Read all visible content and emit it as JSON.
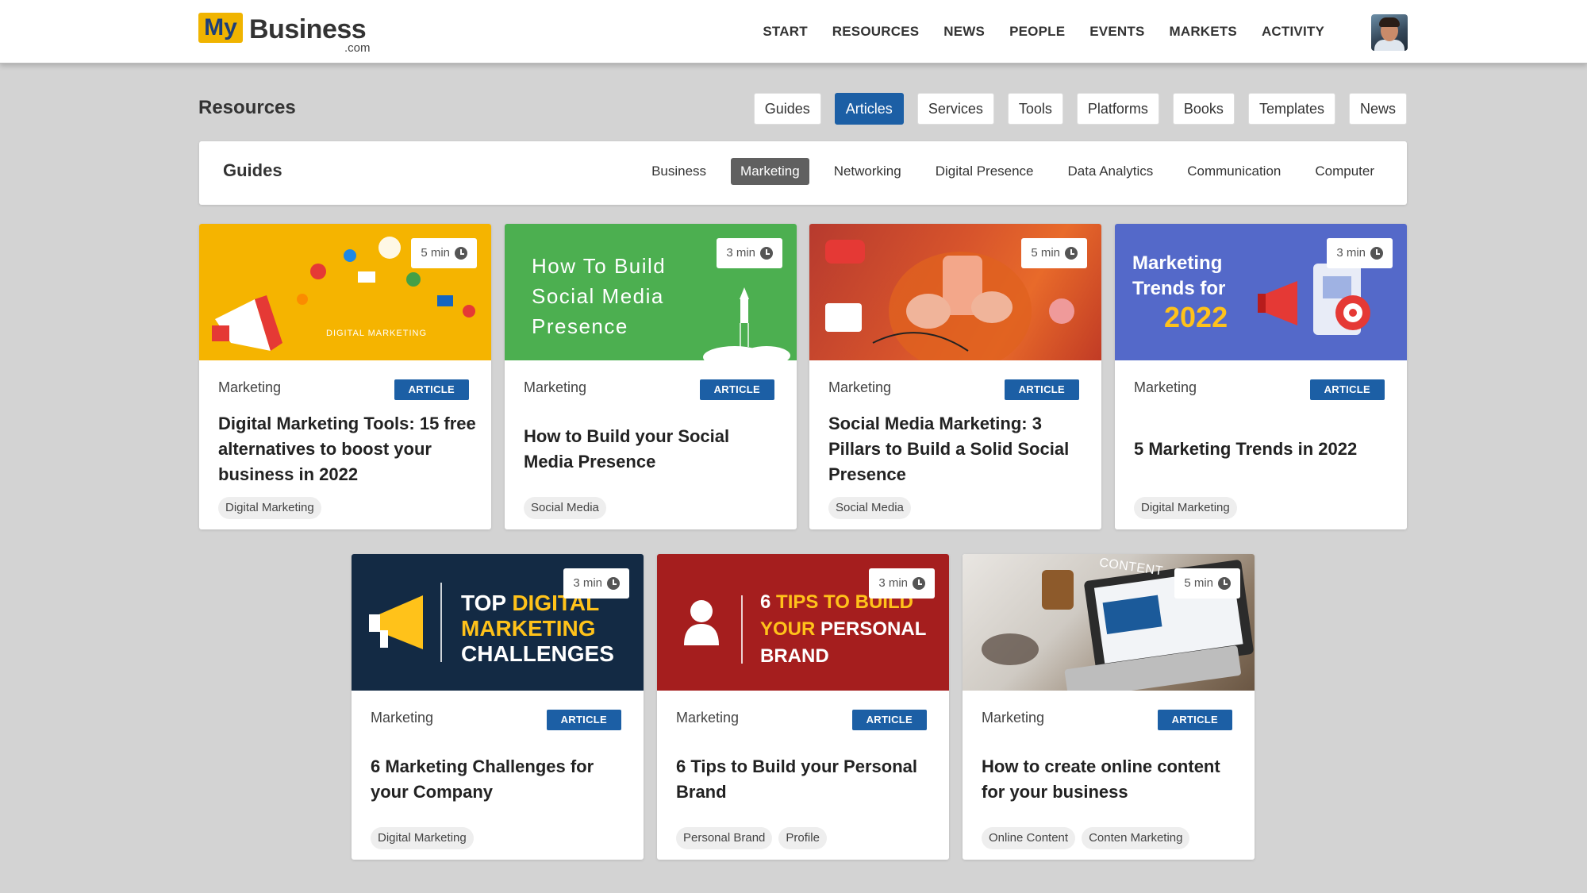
{
  "header": {
    "logo_my": "My",
    "logo_business": "Business",
    "logo_com": ".com",
    "nav": [
      "START",
      "RESOURCES",
      "NEWS",
      "PEOPLE",
      "EVENTS",
      "MARKETS",
      "ACTIVITY"
    ]
  },
  "resources": {
    "title": "Resources",
    "tabs": [
      "Guides",
      "Articles",
      "Services",
      "Tools",
      "Platforms",
      "Books",
      "Templates",
      "News"
    ],
    "active_tab": "Articles"
  },
  "guides": {
    "title": "Guides",
    "tabs": [
      "Business",
      "Marketing",
      "Networking",
      "Digital Presence",
      "Data Analytics",
      "Communication",
      "Computer"
    ],
    "active_tab": "Marketing"
  },
  "cards": [
    {
      "time": "5 min",
      "category": "Marketing",
      "type": "ARTICLE",
      "title": "Digital Marketing Tools: 15 free alternatives to boost your business in 2022",
      "tags": [
        "Digital Marketing"
      ],
      "thumb_text": [
        "DIGITAL MARKETING"
      ]
    },
    {
      "time": "3 min",
      "category": "Marketing",
      "type": "ARTICLE",
      "title": "How to Build your Social Media Presence",
      "tags": [
        "Social Media"
      ],
      "thumb_text": [
        "How To Build",
        "Social Media",
        "Presence"
      ]
    },
    {
      "time": "5 min",
      "category": "Marketing",
      "type": "ARTICLE",
      "title": "Social Media Marketing: 3 Pillars to Build a Solid Social Presence",
      "tags": [
        "Social Media"
      ],
      "thumb_text": []
    },
    {
      "time": "3 min",
      "category": "Marketing",
      "type": "ARTICLE",
      "title": "5 Marketing Trends in 2022",
      "tags": [
        "Digital Marketing"
      ],
      "thumb_text": [
        "Marketing",
        "Trends for",
        "2022"
      ]
    },
    {
      "time": "3 min",
      "category": "Marketing",
      "type": "ARTICLE",
      "title": "6 Marketing Challenges for your Company",
      "tags": [
        "Digital Marketing"
      ],
      "thumb_text": [
        "TOP",
        "DIGITAL",
        "MARKETING",
        "CHALLENGES"
      ]
    },
    {
      "time": "3 min",
      "category": "Marketing",
      "type": "ARTICLE",
      "title": "6 Tips to Build your Personal Brand",
      "tags": [
        "Personal Brand",
        "Profile"
      ],
      "thumb_text": [
        "6",
        "TIPS TO BUILD",
        "YOUR",
        "PERSONAL",
        "BRAND"
      ]
    },
    {
      "time": "5 min",
      "category": "Marketing",
      "type": "ARTICLE",
      "title": "How to create online content for your business",
      "tags": [
        "Online Content",
        "Conten Marketing"
      ],
      "thumb_text": [
        "CONTENT"
      ]
    }
  ],
  "colors": {
    "accent": "#1c5fa5",
    "background": "#d3d3d3",
    "logo_yellow": "#f0b400"
  }
}
